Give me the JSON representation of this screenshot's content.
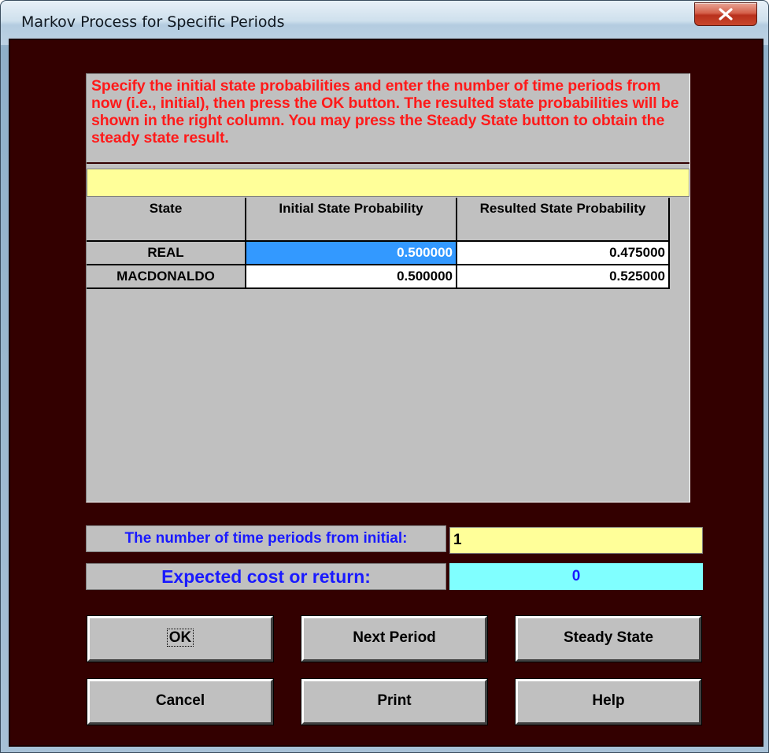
{
  "window": {
    "title": "Markov Process for Specific Periods",
    "close_label": "X"
  },
  "instructions": "Specify the initial state probabilities and enter the number of time periods from now (i.e., initial), then press the OK button.  The resulted state probabilities will be shown in the right column.  You may press the Steady State button to obtain the steady state result.",
  "table": {
    "columns": [
      "State",
      "Initial State Probability",
      "Resulted State Probability"
    ],
    "rows": [
      {
        "state": "REAL",
        "initial": "0.500000",
        "resulted": "0.475000"
      },
      {
        "state": "MACDONALDO",
        "initial": "0.500000",
        "resulted": "0.525000"
      }
    ]
  },
  "periods": {
    "label": "The number of time periods from initial:",
    "value": "1"
  },
  "expected": {
    "label": "Expected cost or return:",
    "value": "0"
  },
  "buttons": {
    "ok": "OK",
    "next_period": "Next Period",
    "steady_state": "Steady State",
    "cancel": "Cancel",
    "print": "Print",
    "help": "Help"
  },
  "colors": {
    "client_bg": "#330000",
    "instructions_text": "#ff1a1a",
    "label_text": "#1a1aff",
    "selection": "#3399ff",
    "input_yellow": "#ffff99",
    "result_cyan": "#80ffff"
  }
}
